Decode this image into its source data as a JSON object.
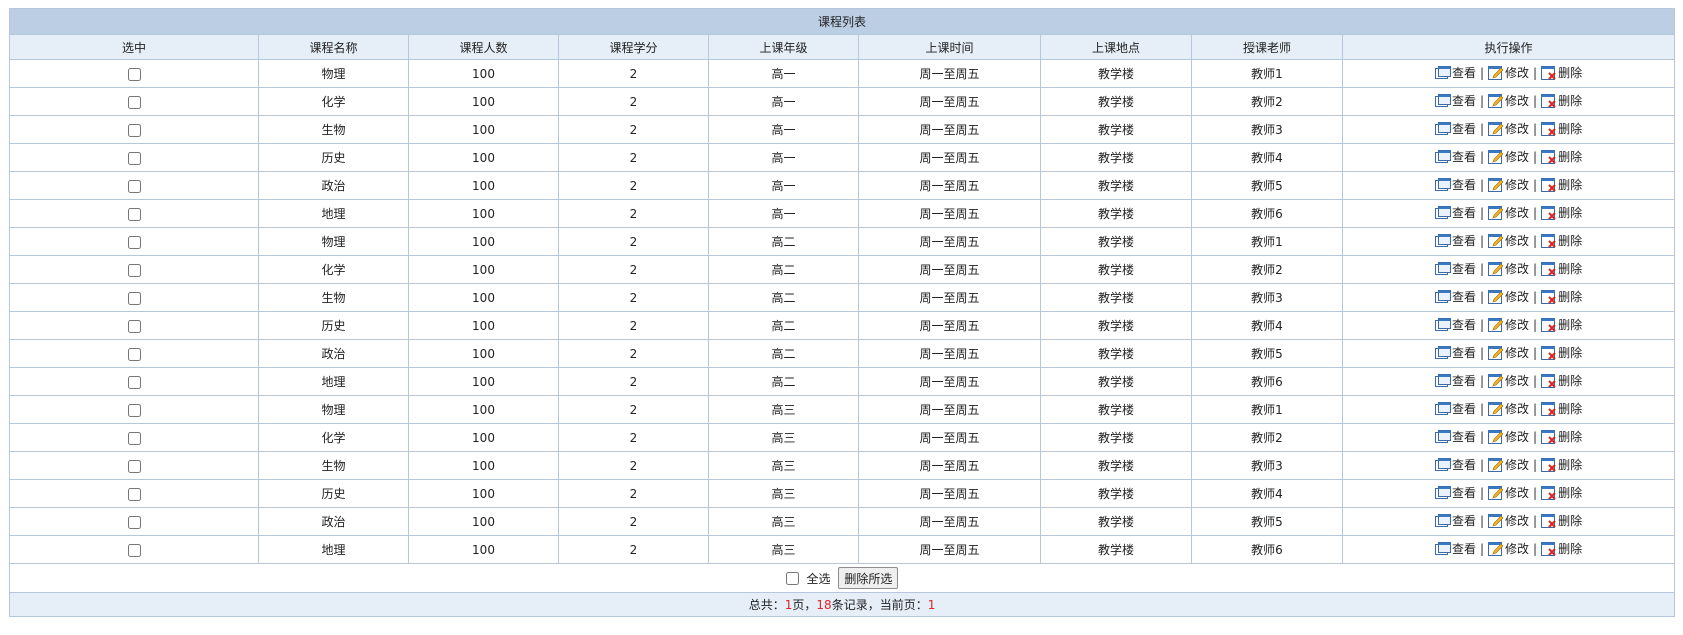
{
  "table": {
    "title": "课程列表",
    "columns": [
      "选中",
      "课程名称",
      "课程人数",
      "课程学分",
      "上课年级",
      "上课时间",
      "上课地点",
      "授课老师",
      "执行操作"
    ],
    "rows": [
      {
        "name": "物理",
        "count": "100",
        "credit": "2",
        "grade": "高一",
        "time": "周一至周五",
        "place": "教学楼",
        "teacher": "教师1"
      },
      {
        "name": "化学",
        "count": "100",
        "credit": "2",
        "grade": "高一",
        "time": "周一至周五",
        "place": "教学楼",
        "teacher": "教师2"
      },
      {
        "name": "生物",
        "count": "100",
        "credit": "2",
        "grade": "高一",
        "time": "周一至周五",
        "place": "教学楼",
        "teacher": "教师3"
      },
      {
        "name": "历史",
        "count": "100",
        "credit": "2",
        "grade": "高一",
        "time": "周一至周五",
        "place": "教学楼",
        "teacher": "教师4"
      },
      {
        "name": "政治",
        "count": "100",
        "credit": "2",
        "grade": "高一",
        "time": "周一至周五",
        "place": "教学楼",
        "teacher": "教师5"
      },
      {
        "name": "地理",
        "count": "100",
        "credit": "2",
        "grade": "高一",
        "time": "周一至周五",
        "place": "教学楼",
        "teacher": "教师6"
      },
      {
        "name": "物理",
        "count": "100",
        "credit": "2",
        "grade": "高二",
        "time": "周一至周五",
        "place": "教学楼",
        "teacher": "教师1"
      },
      {
        "name": "化学",
        "count": "100",
        "credit": "2",
        "grade": "高二",
        "time": "周一至周五",
        "place": "教学楼",
        "teacher": "教师2"
      },
      {
        "name": "生物",
        "count": "100",
        "credit": "2",
        "grade": "高二",
        "time": "周一至周五",
        "place": "教学楼",
        "teacher": "教师3"
      },
      {
        "name": "历史",
        "count": "100",
        "credit": "2",
        "grade": "高二",
        "time": "周一至周五",
        "place": "教学楼",
        "teacher": "教师4"
      },
      {
        "name": "政治",
        "count": "100",
        "credit": "2",
        "grade": "高二",
        "time": "周一至周五",
        "place": "教学楼",
        "teacher": "教师5"
      },
      {
        "name": "地理",
        "count": "100",
        "credit": "2",
        "grade": "高二",
        "time": "周一至周五",
        "place": "教学楼",
        "teacher": "教师6"
      },
      {
        "name": "物理",
        "count": "100",
        "credit": "2",
        "grade": "高三",
        "time": "周一至周五",
        "place": "教学楼",
        "teacher": "教师1"
      },
      {
        "name": "化学",
        "count": "100",
        "credit": "2",
        "grade": "高三",
        "time": "周一至周五",
        "place": "教学楼",
        "teacher": "教师2"
      },
      {
        "name": "生物",
        "count": "100",
        "credit": "2",
        "grade": "高三",
        "time": "周一至周五",
        "place": "教学楼",
        "teacher": "教师3"
      },
      {
        "name": "历史",
        "count": "100",
        "credit": "2",
        "grade": "高三",
        "time": "周一至周五",
        "place": "教学楼",
        "teacher": "教师4"
      },
      {
        "name": "政治",
        "count": "100",
        "credit": "2",
        "grade": "高三",
        "time": "周一至周五",
        "place": "教学楼",
        "teacher": "教师5"
      },
      {
        "name": "地理",
        "count": "100",
        "credit": "2",
        "grade": "高三",
        "time": "周一至周五",
        "place": "教学楼",
        "teacher": "教师6"
      }
    ],
    "actions": {
      "view": "查看",
      "edit": "修改",
      "delete": "删除",
      "separator": "|"
    },
    "icons": {
      "view": "view-icon",
      "edit": "edit-icon",
      "delete": "delete-icon"
    }
  },
  "footer": {
    "select_all_label": "全选",
    "delete_selected_label": "删除所选"
  },
  "pager": {
    "prefix": "总共：",
    "total_pages": "1",
    "pages_suffix": "页，",
    "total_records": "18",
    "records_suffix": "条记录，当前页：",
    "current_page": "1"
  },
  "colors": {
    "title_bg": "#bccee4",
    "header_bg": "#e6eef8",
    "border": "#b7c7db",
    "highlight": "#e0242a"
  }
}
